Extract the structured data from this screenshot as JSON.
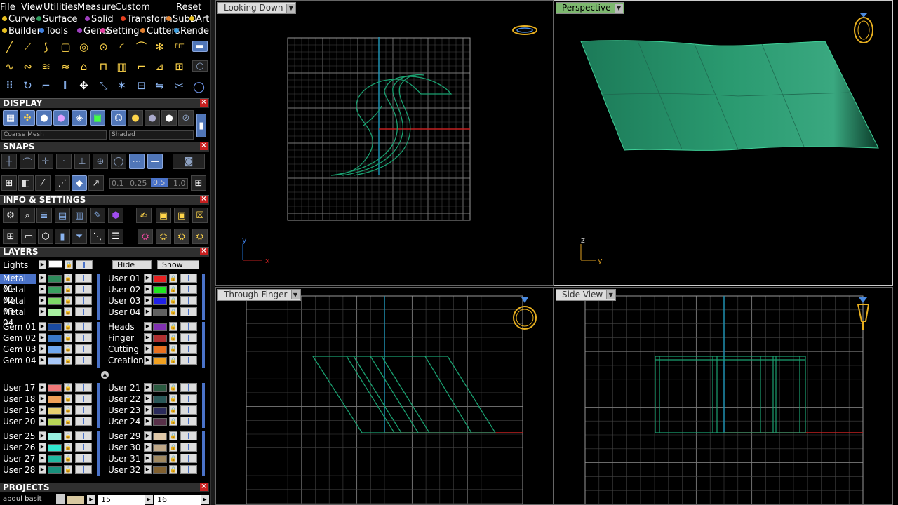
{
  "menu": [
    "File",
    "View",
    "Utilities",
    "Measure",
    "Custom",
    "Reset"
  ],
  "tabs_row1": [
    {
      "label": "Curve",
      "color": "#e8c020"
    },
    {
      "label": "Surface",
      "color": "#2c9a5c"
    },
    {
      "label": "Solid",
      "color": "#a040c0"
    },
    {
      "label": "Transform",
      "color": "#e84020"
    },
    {
      "label": "SubD",
      "color": "#e08030"
    },
    {
      "label": "Art",
      "color": "#e8c020"
    }
  ],
  "tabs_row2": [
    {
      "label": "Builder",
      "color": "#e8c020"
    },
    {
      "label": "Tools",
      "color": "#4080e0"
    },
    {
      "label": "Gems",
      "color": "#a040c0"
    },
    {
      "label": "Setting",
      "color": "#e040a0"
    },
    {
      "label": "Cutters",
      "color": "#e08030"
    },
    {
      "label": "Render",
      "color": "#40a0e0"
    }
  ],
  "sections": {
    "display": "DISPLAY",
    "snaps": "SNAPS",
    "info": "INFO & SETTINGS",
    "layers": "LAYERS",
    "projects": "PROJECTS"
  },
  "display": {
    "mesh_combo": "Coarse Mesh",
    "shade_combo": "Shaded"
  },
  "snap_values": [
    "0.1",
    "0.25",
    "0.5",
    "1.0"
  ],
  "layers": {
    "lights": "Lights",
    "hide": "Hide",
    "show": "Show",
    "left": [
      {
        "name": "Metal 01",
        "color": "#2e8a5a",
        "sel": true
      },
      {
        "name": "Metal 02",
        "color": "#3aa060"
      },
      {
        "name": "Metal 03",
        "color": "#7ed868"
      },
      {
        "name": "Metal 04",
        "color": "#a8f0a0"
      },
      {
        "name": "Gem 01",
        "color": "#1a4aa0"
      },
      {
        "name": "Gem 02",
        "color": "#3a78c8"
      },
      {
        "name": "Gem 03",
        "color": "#70a8f0"
      },
      {
        "name": "Gem 04",
        "color": "#a8c8f8"
      },
      {
        "name": "User 17",
        "color": "#f07878"
      },
      {
        "name": "User 18",
        "color": "#f0a058"
      },
      {
        "name": "User 19",
        "color": "#e8d070"
      },
      {
        "name": "User 20",
        "color": "#b8d858"
      },
      {
        "name": "User 25",
        "color": "#98f0e0"
      },
      {
        "name": "User 26",
        "color": "#30e8d0"
      },
      {
        "name": "User 27",
        "color": "#20b8a0"
      },
      {
        "name": "User 28",
        "color": "#18907c"
      }
    ],
    "right": [
      {
        "name": "User 01",
        "color": "#e82020"
      },
      {
        "name": "User 02",
        "color": "#20e820"
      },
      {
        "name": "User 03",
        "color": "#2020e8"
      },
      {
        "name": "User 04",
        "color": "#606060"
      },
      {
        "name": "Heads",
        "color": "#8030b0"
      },
      {
        "name": "Finger",
        "color": "#b03030"
      },
      {
        "name": "Cutting",
        "color": "#e87020"
      },
      {
        "name": "Creation",
        "color": "#f0a020"
      },
      {
        "name": "User 21",
        "color": "#2a5a40"
      },
      {
        "name": "User 22",
        "color": "#2a5858"
      },
      {
        "name": "User 23",
        "color": "#2a2a5a"
      },
      {
        "name": "User 24",
        "color": "#583048"
      },
      {
        "name": "User 29",
        "color": "#e0c8a8"
      },
      {
        "name": "User 30",
        "color": "#c0a888"
      },
      {
        "name": "User 31",
        "color": "#a08860"
      },
      {
        "name": "User 32",
        "color": "#806030"
      }
    ]
  },
  "projects": {
    "name": "abdul basit",
    "v1": "15",
    "v2": "16"
  },
  "viewports": [
    {
      "label": "Looking Down",
      "active": false
    },
    {
      "label": "Perspective",
      "active": true
    },
    {
      "label": "Through Finger",
      "active": false
    },
    {
      "label": "Side View",
      "active": false
    }
  ],
  "axes": {
    "top_left": [
      "y",
      "x"
    ],
    "top_right": [
      "z",
      "y"
    ]
  }
}
